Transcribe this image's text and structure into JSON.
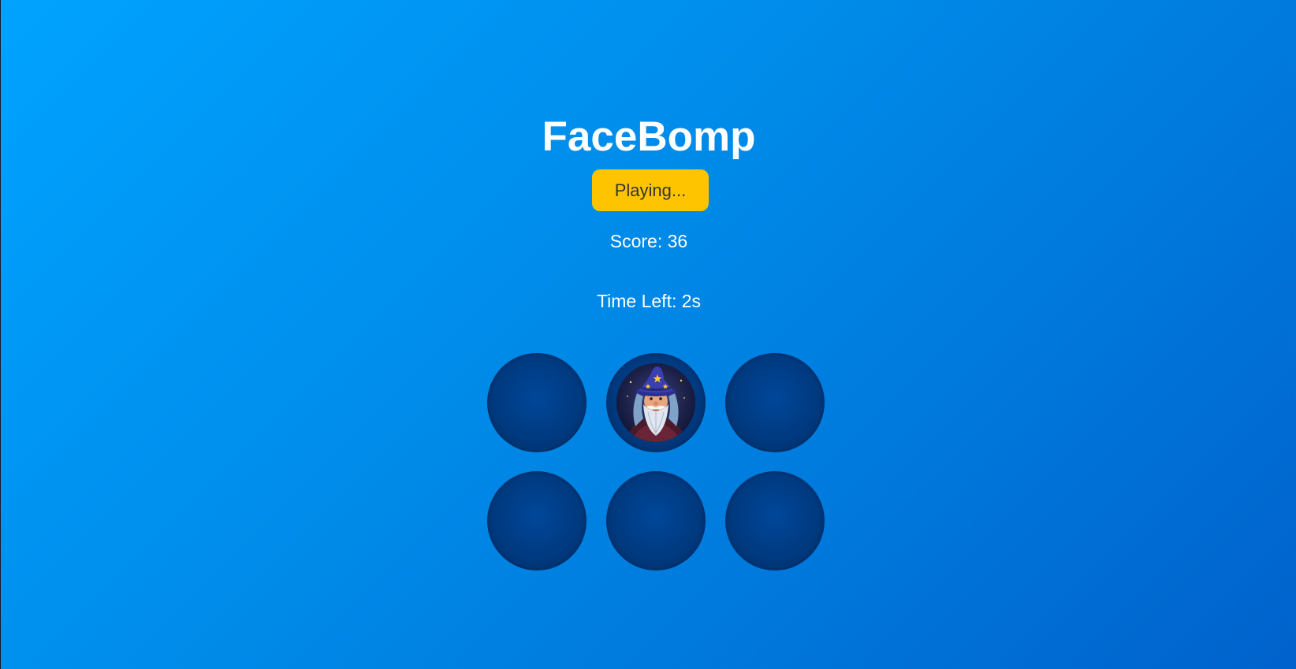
{
  "game": {
    "title": "FaceBomp",
    "status_label": "Playing...",
    "score_text": "Score: 36",
    "timer_text": "Time Left: 2s"
  },
  "board": {
    "rows": 2,
    "columns": 3,
    "holes": [
      {
        "id": 1,
        "occupied": false
      },
      {
        "id": 2,
        "occupied": true,
        "face": "wizard-face-icon"
      },
      {
        "id": 3,
        "occupied": false
      },
      {
        "id": 4,
        "occupied": false
      },
      {
        "id": 5,
        "occupied": false
      },
      {
        "id": 6,
        "occupied": false
      }
    ]
  },
  "colors": {
    "background_start": "#00a3ff",
    "background_end": "#0062cc",
    "button": "#ffc400",
    "hole": "#003a80",
    "text": "#ffffff"
  }
}
